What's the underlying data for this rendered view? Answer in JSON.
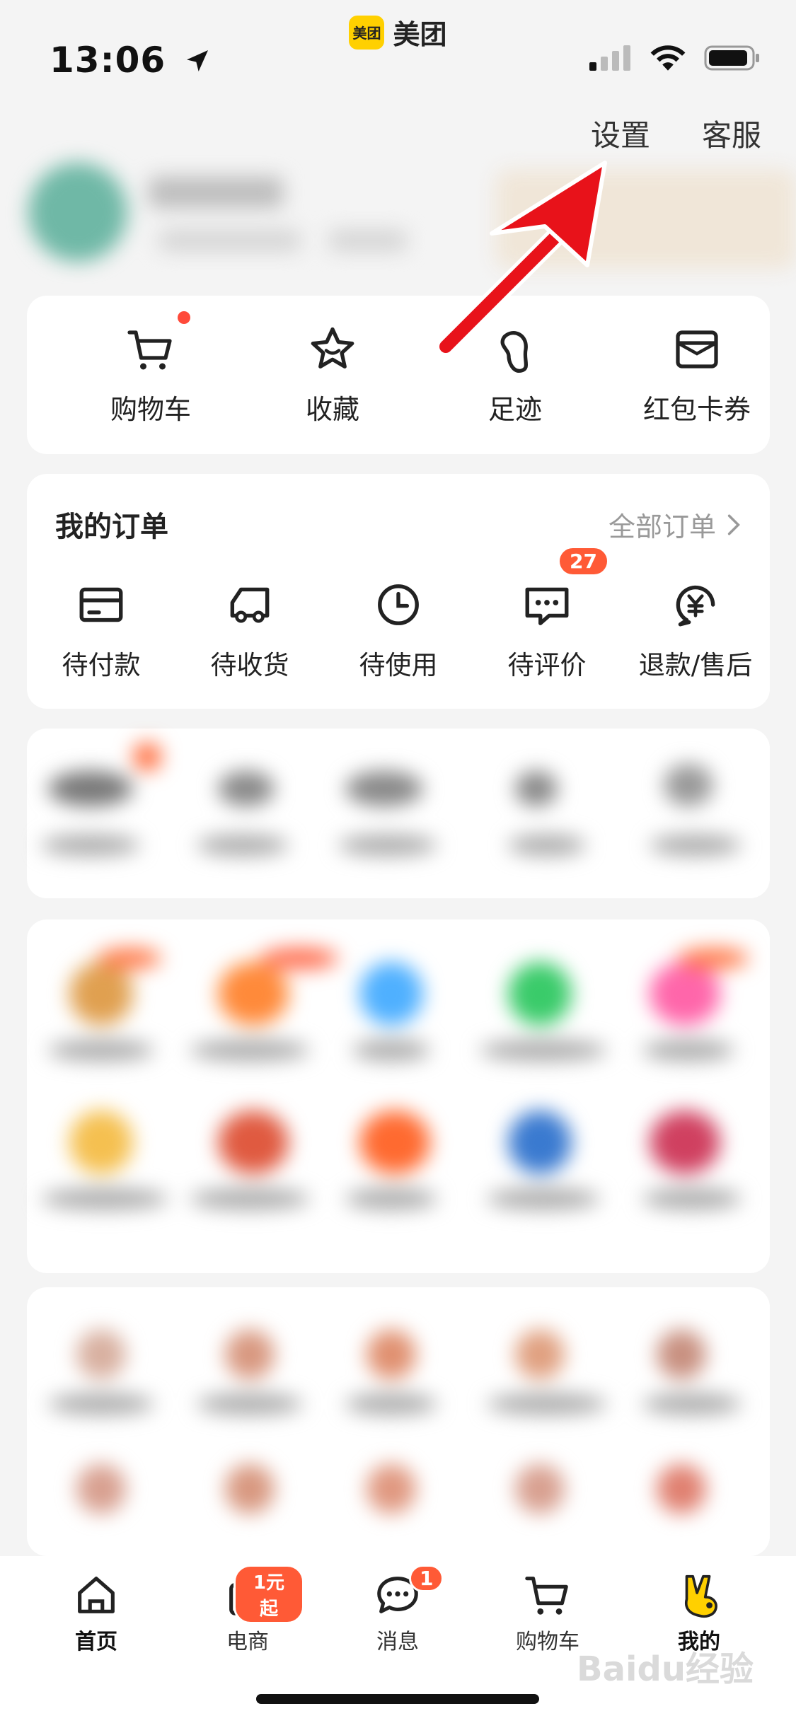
{
  "status_bar": {
    "time": "13:06"
  },
  "app": {
    "logo_text": "美团",
    "name": "美团"
  },
  "header": {
    "settings_label": "设置",
    "service_label": "客服"
  },
  "quick_links": [
    {
      "label": "购物车",
      "icon": "cart-icon"
    },
    {
      "label": "收藏",
      "icon": "star-icon"
    },
    {
      "label": "足迹",
      "icon": "footprint-icon"
    },
    {
      "label": "红包卡券",
      "icon": "wallet-icon"
    }
  ],
  "orders": {
    "title": "我的订单",
    "all_label": "全部订单",
    "items": [
      {
        "label": "待付款",
        "icon": "card-icon"
      },
      {
        "label": "待收货",
        "icon": "truck-icon"
      },
      {
        "label": "待使用",
        "icon": "clock-icon"
      },
      {
        "label": "待评价",
        "icon": "comment-icon",
        "badge": "27"
      },
      {
        "label": "退款/售后",
        "icon": "refund-icon"
      }
    ]
  },
  "tabbar": {
    "items": [
      {
        "label": "首页",
        "icon": "home-icon",
        "active": true
      },
      {
        "label": "电商",
        "icon": "bag-icon",
        "badge": "1元起"
      },
      {
        "label": "消息",
        "icon": "message-icon",
        "badge": "1"
      },
      {
        "label": "购物车",
        "icon": "cart-icon"
      },
      {
        "label": "我的",
        "icon": "profile-mascot-icon",
        "active": true
      }
    ]
  },
  "watermark": "Baidu经验",
  "colors": {
    "accent": "#ffd000",
    "badge": "#ff5a36",
    "arrow": "#e8121a"
  }
}
